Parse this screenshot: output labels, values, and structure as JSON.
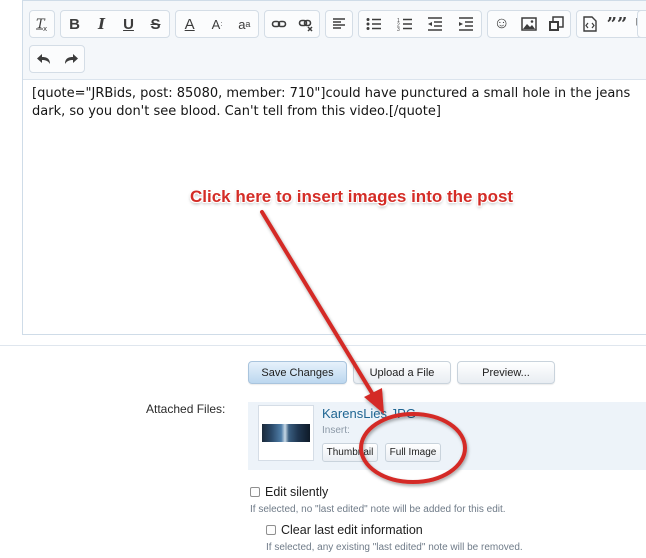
{
  "toolbar": {
    "row1": [
      {
        "name": "clear-formatting",
        "glyph": "Tx"
      },
      {
        "name": "bold",
        "glyph": "B"
      },
      {
        "name": "italic",
        "glyph": "I"
      },
      {
        "name": "underline",
        "glyph": "U"
      },
      {
        "name": "strikethrough",
        "glyph": "S"
      },
      {
        "name": "font-color",
        "glyph": "A"
      },
      {
        "name": "font-size",
        "glyph": "A"
      },
      {
        "name": "font-family",
        "glyph": "a"
      },
      {
        "name": "link",
        "glyph": ""
      },
      {
        "name": "unlink",
        "glyph": ""
      },
      {
        "name": "align",
        "glyph": ""
      },
      {
        "name": "bullet-list",
        "glyph": ""
      },
      {
        "name": "numbered-list",
        "glyph": ""
      },
      {
        "name": "outdent",
        "glyph": ""
      },
      {
        "name": "indent",
        "glyph": ""
      },
      {
        "name": "smilies",
        "glyph": "☺"
      },
      {
        "name": "insert-image",
        "glyph": ""
      },
      {
        "name": "media",
        "glyph": ""
      },
      {
        "name": "code",
        "glyph": ""
      },
      {
        "name": "quote",
        "glyph": "””"
      },
      {
        "name": "toggle-bbcode",
        "glyph": ""
      }
    ],
    "undo_glyph": "↶",
    "redo_glyph": "↷"
  },
  "editor": {
    "line1": "[quote=\"JRBids, post: 85080, member: 710\"]could have punctured a small hole in the jeans",
    "line2": "dark, so you don't see blood. Can't tell from this video.[/quote]"
  },
  "buttons": {
    "save": "Save Changes",
    "upload": "Upload a File",
    "preview": "Preview..."
  },
  "attachments": {
    "label": "Attached Files:",
    "file_name": "KarensLies.JPG",
    "insert_label": "Insert:",
    "thumbnail_button": "Thumbnail",
    "full_image_button": "Full Image"
  },
  "options": {
    "edit_silently": "Edit silently",
    "edit_silently_hint": "If selected, no \"last edited\" note will be added for this edit.",
    "clear_last_edit": "Clear last edit information",
    "clear_last_edit_hint": "If selected, any existing \"last edited\" note will be removed."
  },
  "annotation": {
    "text": "Click here to insert images into the post",
    "color": "#d42c26"
  }
}
